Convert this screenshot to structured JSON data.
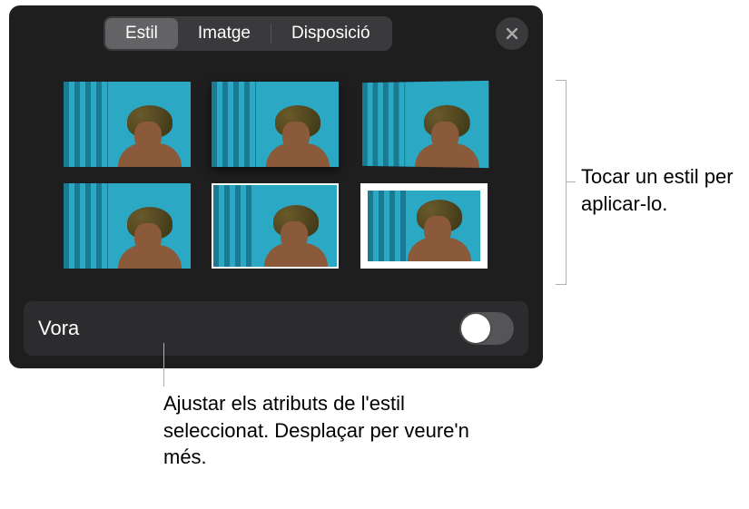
{
  "tabs": {
    "style": "Estil",
    "image": "Imatge",
    "layout": "Disposició"
  },
  "settings": {
    "border_label": "Vora",
    "border_enabled": false
  },
  "callouts": {
    "tap_style": "Tocar un estil per aplicar-lo.",
    "adjust_attrs": "Ajustar els atributs de l'estil seleccionat. Desplaçar per veure'n més."
  },
  "styles": [
    {
      "name": "plain"
    },
    {
      "name": "shadow"
    },
    {
      "name": "tilted"
    },
    {
      "name": "reflection"
    },
    {
      "name": "thin-border"
    },
    {
      "name": "thick-border"
    }
  ]
}
